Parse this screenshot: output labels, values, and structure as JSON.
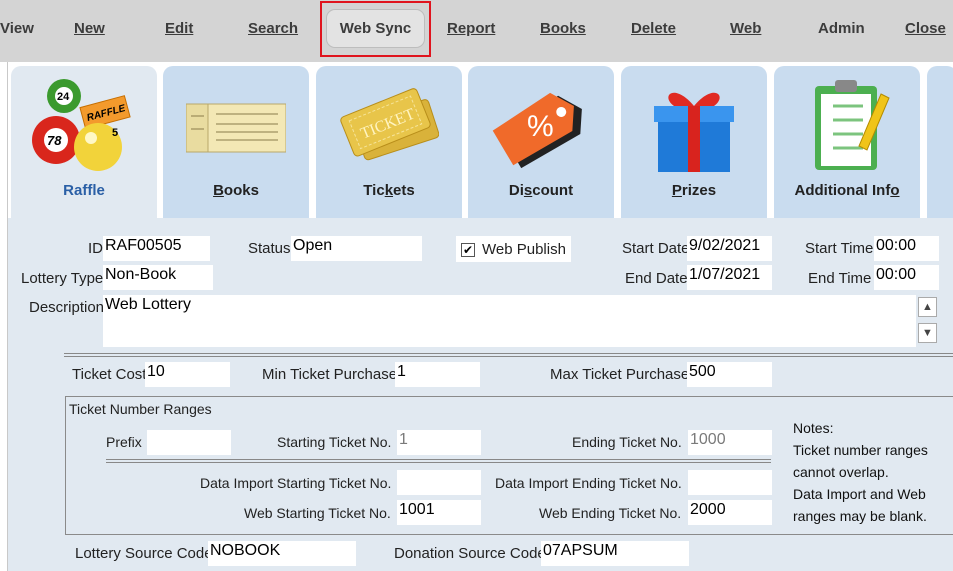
{
  "menu": [
    "View",
    "New",
    "Edit",
    "Search",
    "Web Sync",
    "Report",
    "Books",
    "Delete",
    "Web",
    "Admin",
    "Close"
  ],
  "tabs": [
    "Raffle",
    "Books",
    "Tickets",
    "Discount",
    "Prizes",
    "Additional Info"
  ],
  "icons": {
    "raffle": "raffle-balls-icon",
    "books": "ticket-book-icon",
    "tickets": "tickets-icon",
    "discount": "discount-tag-icon",
    "prizes": "gift-box-icon",
    "info": "clipboard-icon"
  },
  "raffle_badge": "RAFFLE",
  "ball_numbers": [
    "24",
    "78",
    "5"
  ],
  "form": {
    "id_label": "ID",
    "id_value": "RAF00505",
    "status_label": "Status",
    "status_value": "Open",
    "web_publish_label": "Web Publish",
    "web_publish_checked": true,
    "start_date_label": "Start Date",
    "start_date_value": "9/02/2021",
    "start_time_label": "Start Time",
    "start_time_value": "00:00",
    "lottery_type_label": "Lottery Type",
    "lottery_type_value": "Non-Book",
    "end_date_label": "End Date",
    "end_date_value": "1/07/2021",
    "end_time_label": "End Time",
    "end_time_value": "00:00",
    "description_label": "Description",
    "description_value": "Web Lottery",
    "ticket_cost_label": "Ticket Cost",
    "ticket_cost_value": "10",
    "min_purchase_label": "Min Ticket Purchase",
    "min_purchase_value": "1",
    "max_purchase_label": "Max Ticket Purchase",
    "max_purchase_value": "500",
    "ranges_title": "Ticket Number Ranges",
    "prefix_label": "Prefix",
    "prefix_value": "",
    "starting_label": "Starting Ticket No.",
    "starting_value": "1",
    "ending_label": "Ending Ticket No.",
    "ending_value": "1000",
    "import_start_label": "Data Import Starting Ticket No.",
    "import_start_value": "",
    "import_end_label": "Data Import Ending Ticket No.",
    "import_end_value": "",
    "web_start_label": "Web Starting Ticket No.",
    "web_start_value": "1001",
    "web_end_label": "Web Ending Ticket No.",
    "web_end_value": "2000",
    "notes": [
      "Notes:",
      "Ticket number ranges",
      "cannot overlap.",
      "Data Import and Web",
      "ranges may be blank."
    ],
    "lottery_source_label": "Lottery Source Code",
    "lottery_source_value": "NOBOOK",
    "donation_source_label": "Donation Source Code",
    "donation_source_value": "07APSUM"
  },
  "colors": {
    "highlight": "#e0141e",
    "active_tab_label": "#2a5fa6",
    "panel": "#e1e9f1",
    "tab": "#c9dcef"
  }
}
